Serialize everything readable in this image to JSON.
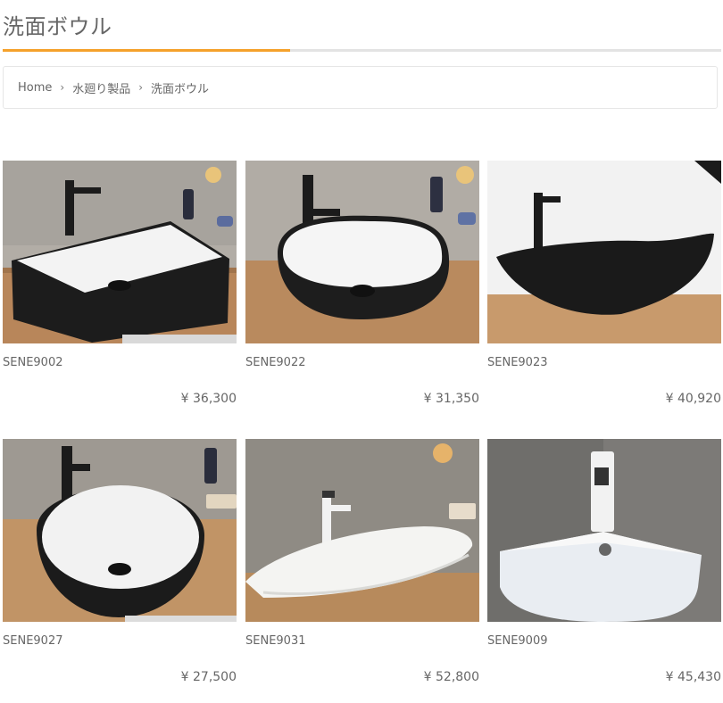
{
  "page": {
    "title": "洗面ボウル"
  },
  "breadcrumb": {
    "home": "Home",
    "category": "水廻り製品",
    "current": "洗面ボウル"
  },
  "products": [
    {
      "sku": "SENE9002",
      "price": "¥ 36,300",
      "image_icon": "rectangular-black-vessel-sink"
    },
    {
      "sku": "SENE9022",
      "price": "¥ 31,350",
      "image_icon": "rounded-black-vessel-sink"
    },
    {
      "sku": "SENE9023",
      "price": "¥ 40,920",
      "image_icon": "boat-black-vessel-sink"
    },
    {
      "sku": "SENE9027",
      "price": "¥ 27,500",
      "image_icon": "round-black-vessel-sink"
    },
    {
      "sku": "SENE9031",
      "price": "¥ 52,800",
      "image_icon": "white-boat-vessel-sink"
    },
    {
      "sku": "SENE9009",
      "price": "¥ 45,430",
      "image_icon": "white-corner-sink"
    }
  ],
  "colors": {
    "accent": "#f5a12b",
    "rule": "#e3e3e3"
  }
}
